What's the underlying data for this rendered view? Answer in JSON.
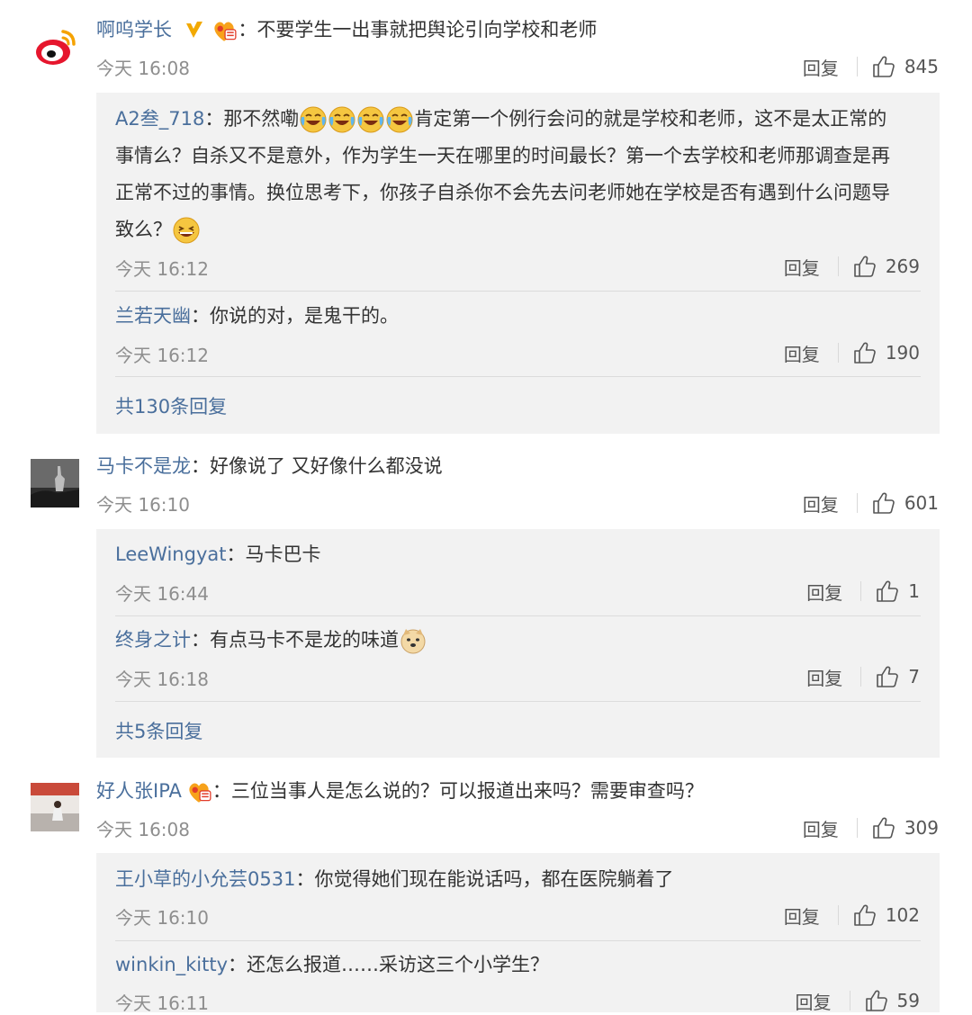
{
  "comments": [
    {
      "user": "啊呜学长",
      "text": "不要学生一出事就把舆论引向学校和老师",
      "time": "今天 16:08",
      "reply_label": "回复",
      "likes": "845",
      "replies": [
        {
          "user": "A2叁_718",
          "text_a": "那不然嘞",
          "text_b": "肯定第一个例行会问的就是学校和老师，这不是太正常的",
          "line2": "事情么？自杀又不是意外，作为学生一天在哪里的时间最长？第一个去学校和老师那调查是再",
          "line3": "正常不过的事情。换位思考下，你孩子自杀你不会先去问老师她在学校是否有遇到什么问题导",
          "line4": "致么？",
          "time": "今天 16:12",
          "reply_label": "回复",
          "likes": "269"
        },
        {
          "user": "兰若天幽",
          "text": "你说的对，是鬼干的。",
          "time": "今天 16:12",
          "reply_label": "回复",
          "likes": "190"
        }
      ],
      "more": "共130条回复"
    },
    {
      "user": "马卡不是龙",
      "text": "好像说了 又好像什么都没说",
      "time": "今天 16:10",
      "reply_label": "回复",
      "likes": "601",
      "replies": [
        {
          "user": "LeeWingyat",
          "text": "马卡巴卡",
          "time": "今天 16:44",
          "reply_label": "回复",
          "likes": "1"
        },
        {
          "user": "终身之计",
          "text": "有点马卡不是龙的味道",
          "time": "今天 16:18",
          "reply_label": "回复",
          "likes": "7"
        }
      ],
      "more": "共5条回复"
    },
    {
      "user": "好人张IPA",
      "text": "三位当事人是怎么说的？可以报道出来吗？需要审查吗？",
      "time": "今天 16:08",
      "reply_label": "回复",
      "likes": "309",
      "replies": [
        {
          "user": "王小草的小允芸0531",
          "text": "你觉得她们现在能说话吗，都在医院躺着了",
          "time": "今天 16:10",
          "reply_label": "回复",
          "likes": "102"
        },
        {
          "user": "winkin_kitty",
          "text": "还怎么报道……采访这三个小学生？",
          "time": "今天 16:11",
          "reply_label": "回复",
          "likes": "59"
        }
      ]
    }
  ],
  "colon": "：",
  "icons": {
    "weibo_logo": "weibo-logo",
    "verified": "verified-v-icon",
    "fan_badge": "fan-badge-icon",
    "like": "thumbs-up-icon",
    "emoji_cry_laugh": "tears-of-joy-emoji",
    "emoji_laugh": "laughing-emoji",
    "emoji_doge": "doge-emoji"
  },
  "colors": {
    "username": "#4a6f9c",
    "time": "#8e8e8e",
    "sub_bg": "#f2f2f2",
    "verified": "#f2a900"
  }
}
